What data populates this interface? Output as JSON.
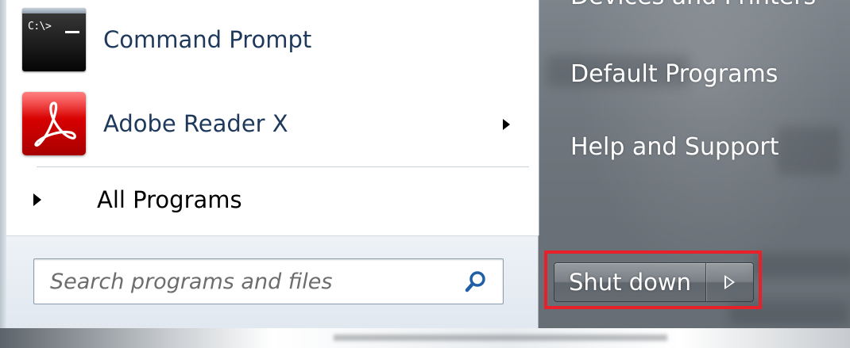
{
  "start_menu": {
    "programs": [
      {
        "label": "Command Prompt",
        "icon": "command-prompt-icon",
        "icon_text": "C:\\>"
      },
      {
        "label": "Adobe Reader X",
        "icon": "adobe-reader-icon",
        "has_submenu": true
      }
    ],
    "all_programs_label": "All Programs",
    "search": {
      "placeholder": "Search programs and files",
      "value": ""
    },
    "right_items": [
      {
        "label": "Devices and Printers"
      },
      {
        "label": "Default Programs"
      },
      {
        "label": "Help and Support"
      }
    ],
    "shutdown": {
      "label": "Shut down",
      "highlight_color": "#e8202a"
    }
  }
}
